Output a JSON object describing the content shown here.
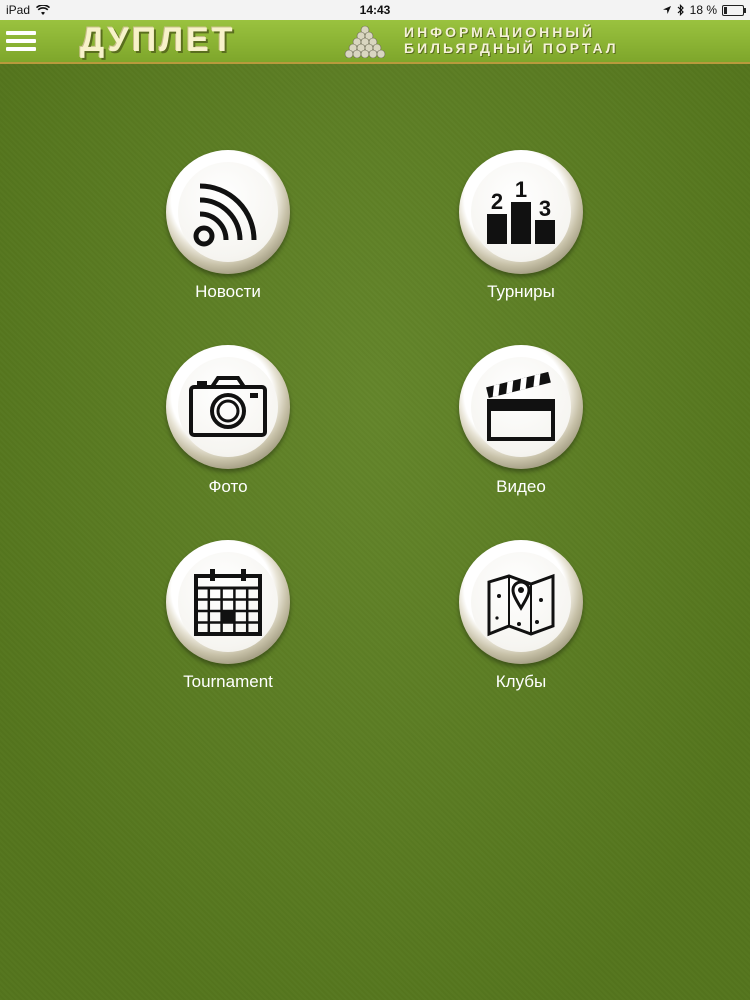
{
  "status_bar": {
    "device": "iPad",
    "time": "14:43",
    "battery_text": "18 %",
    "battery_level": 0.18
  },
  "header": {
    "logo_main": "ДУПЛЕТ",
    "logo_line1": "ИНФОРМАЦИОННЫЙ",
    "logo_line2": "БИЛЬЯРДНЫЙ ПОРТАЛ"
  },
  "menu": {
    "items": [
      {
        "label": "Новости",
        "icon": "rss-icon"
      },
      {
        "label": "Турниры",
        "icon": "podium-icon"
      },
      {
        "label": "Фото",
        "icon": "camera-icon"
      },
      {
        "label": "Видео",
        "icon": "clapperboard-icon"
      },
      {
        "label": "Tournament",
        "icon": "calendar-icon"
      },
      {
        "label": "Клубы",
        "icon": "map-icon"
      }
    ]
  },
  "podium_digits": [
    "2",
    "1",
    "3"
  ],
  "colors": {
    "background": "#5b7f1f",
    "header": "#8db536",
    "icon": "#111111"
  }
}
